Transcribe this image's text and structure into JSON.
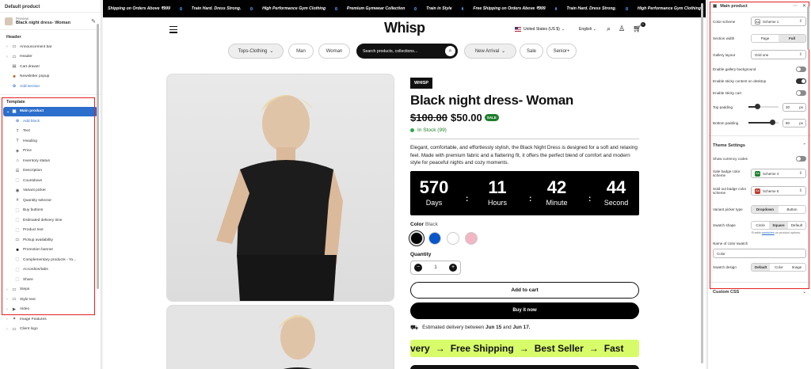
{
  "left": {
    "title": "Default product",
    "preview_label": "Preview",
    "preview_value": "Black night dress- Woman",
    "header_section": "Header",
    "header_items": [
      {
        "label": "Announcement bar",
        "icon": "announcement-icon"
      },
      {
        "label": "Header",
        "icon": "layout-icon"
      },
      {
        "label": "Cart drawer",
        "icon": "cart-drawer-icon"
      },
      {
        "label": "Newsletter popup",
        "icon": "popup-icon"
      }
    ],
    "add_section": "Add section",
    "template_section": "Template",
    "main_product": "Main product",
    "add_block": "Add block",
    "blocks": [
      "Text",
      "Heading",
      "Price",
      "Inventory status",
      "Description",
      "Countdown",
      "Variant picker",
      "Quantity selector",
      "Buy buttons",
      "Estimated delivery time",
      "Product text",
      "Pickup availability",
      "Promotion banner",
      "Complementary products - Yo...",
      "Accordion/tabs",
      "Share"
    ],
    "after": [
      "Steps",
      "Style text",
      "Video",
      "Image Features",
      "Client logo"
    ]
  },
  "store": {
    "announcements": [
      "Shipping on Orders Above ₹999",
      "Train Hard. Dress Strong.",
      "High Performance Gym Clothing",
      "Premium Gymwear Collection",
      "Train in Style",
      "Free Shipping on Orders Above ₹999",
      "Train Hard. Dress Strong.",
      "High Performance Gym Clothing"
    ],
    "logo": "Whisp",
    "country": "United States (US $)",
    "language": "English",
    "cart_count": "0",
    "menu": {
      "tops": "Tops-Clothing",
      "man": "Man",
      "woman": "Woman",
      "search_placeholder": "Search products, collections...",
      "new_arrival": "New Arrival",
      "sale": "Sale",
      "senior": "Senior+"
    },
    "product": {
      "vendor": "WHISP",
      "title": "Black night dress- Woman",
      "old_price": "$100.00",
      "price": "$50.00",
      "sale_badge": "SALE",
      "stock": "In Stock (99)",
      "description": "Elegant, comfortable, and effortlessly stylish, the Black Night Dress is designed for a soft and relaxing feel. Made with premium fabric and a flattering fit, it offers the perfect blend of comfort and modern style for peaceful nights and cozy moments.",
      "countdown": [
        {
          "value": "570",
          "label": "Days"
        },
        {
          "value": "11",
          "label": "Hours"
        },
        {
          "value": "42",
          "label": "Minute"
        },
        {
          "value": "44",
          "label": "Second"
        }
      ],
      "color_label": "Color",
      "color_value": "Black",
      "swatch_colors": [
        "#000000",
        "#0a56c9",
        "#ffffff",
        "#f3b6c3"
      ],
      "quantity_label": "Quantity",
      "quantity": "1",
      "add_to_cart": "Add to cart",
      "buy_now": "Buy it now",
      "delivery_prefix": "Estimated delivery between",
      "delivery_from": "Jun 15",
      "delivery_and": "and",
      "delivery_to": "Jun 17.",
      "promo": [
        "very",
        "→",
        "Free Shipping",
        "→",
        "Best Seller",
        "→",
        "Fast"
      ]
    }
  },
  "right": {
    "title": "Main product",
    "color_scheme_label": "Color scheme",
    "color_scheme_value": "Scheme 1",
    "section_width_label": "Section width",
    "width_options": [
      "Page",
      "Full"
    ],
    "gallery_layout_label": "Gallery layout",
    "gallery_layout_value": "Grid one",
    "toggles": [
      {
        "label": "Enable gallery background",
        "on": false
      },
      {
        "label": "Enable sticky content on desktop",
        "on": true
      },
      {
        "label": "Enable sticky cart",
        "on": false
      }
    ],
    "top_padding_label": "Top padding",
    "top_padding_value": "30",
    "top_padding_fraction": 0.3,
    "bottom_padding_label": "Bottom padding",
    "bottom_padding_value": "80",
    "bottom_padding_fraction": 0.8,
    "unit": "px",
    "theme_settings": "Theme Settings",
    "show_currency_label": "Show currency codes",
    "sale_badge_label": "Sale badge color scheme",
    "sale_badge_value": "Scheme 4",
    "sale_badge_color": "#1e7f2c",
    "sold_out_label": "Sold out badge color scheme",
    "sold_out_value": "Scheme 5",
    "sold_out_color": "#c0392b",
    "variant_picker_label": "Variant picker type",
    "variant_options": [
      "Dropdown",
      "Button"
    ],
    "swatch_shape_label": "Swatch shape",
    "swatch_shape_options": [
      "Circle",
      "Square",
      "Default"
    ],
    "swatch_help_prefix": "Enable",
    "swatch_help_link": "swatches",
    "swatch_help_suffix": "on product options.",
    "name_of_swatch_label": "Name of color swatch",
    "name_of_swatch_value": "Color",
    "swatch_design_label": "Swatch design",
    "swatch_design_options": [
      "Default",
      "Color",
      "Image"
    ],
    "custom_css": "Custom CSS"
  }
}
